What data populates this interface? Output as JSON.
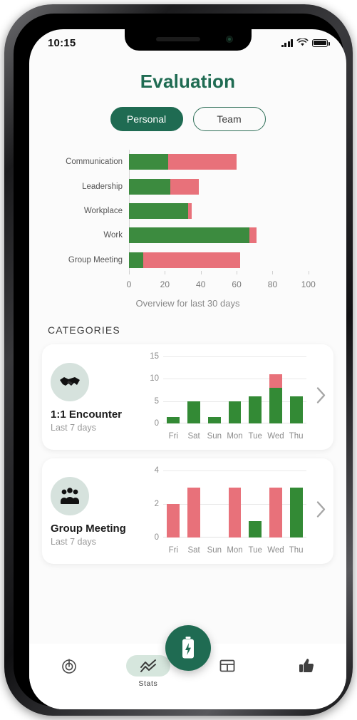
{
  "status_bar": {
    "time": "10:15",
    "signal_icon": "cellular-signal-icon",
    "wifi_icon": "wifi-icon",
    "battery_icon": "battery-icon"
  },
  "header": {
    "title": "Evaluation"
  },
  "segmented": {
    "options": [
      {
        "label": "Personal",
        "active": true
      },
      {
        "label": "Team",
        "active": false
      }
    ]
  },
  "section": {
    "categories_title": "CATEGORIES"
  },
  "colors": {
    "brand_green": "#1f6b52",
    "bar_green": "#3c8b3f",
    "bar_red": "#e8717a",
    "icon_bg": "#d6e2dd",
    "screen_bg": "#fbfbfb"
  },
  "cards": [
    {
      "name": "1:1 Encounter",
      "subtitle": "Last 7 days",
      "icon": "handshake-icon",
      "chevron": "chevron-right-icon"
    },
    {
      "name": "Group Meeting",
      "subtitle": "Last 7 days",
      "icon": "group-people-icon",
      "chevron": "chevron-right-icon"
    }
  ],
  "tabbar": {
    "items": [
      {
        "label": "",
        "icon": "radar-target-icon",
        "active": false
      },
      {
        "label": "Stats",
        "icon": "chart-lines-icon",
        "active": true
      },
      {
        "label": "",
        "icon": "table-layout-icon",
        "active": false
      },
      {
        "label": "",
        "icon": "thumbs-up-icon",
        "active": false
      }
    ],
    "fab_icon": "battery-bolt-icon"
  },
  "chart_data": [
    {
      "type": "bar",
      "orientation": "horizontal",
      "stacked": true,
      "title": "",
      "caption": "Overview for last 30 days",
      "categories": [
        "Communication",
        "Leadership",
        "Workplace",
        "Work",
        "Group Meeting"
      ],
      "series": [
        {
          "name": "positive",
          "color": "#3c8b3f",
          "values": [
            22,
            23,
            33,
            67,
            8
          ]
        },
        {
          "name": "negative",
          "color": "#e8717a",
          "values": [
            38,
            16,
            2,
            4,
            54
          ]
        }
      ],
      "totals": [
        60,
        39,
        35,
        71,
        62
      ],
      "xlabel": "",
      "ylabel": "",
      "xlim": [
        0,
        110
      ],
      "xticks": [
        0,
        20,
        40,
        60,
        80,
        100
      ],
      "ticklabels": [
        "0",
        "20",
        "40",
        "60",
        "80",
        "100"
      ],
      "grid": false,
      "legend": "none"
    },
    {
      "type": "bar",
      "orientation": "vertical",
      "stacked": true,
      "title": "1:1 Encounter",
      "categories": [
        "Fri",
        "Sat",
        "Sun",
        "Mon",
        "Tue",
        "Wed",
        "Thu"
      ],
      "series": [
        {
          "name": "positive",
          "color": "#338a35",
          "values": [
            1.5,
            5,
            1.5,
            5,
            6,
            8,
            6
          ]
        },
        {
          "name": "negative",
          "color": "#e8717a",
          "values": [
            0,
            0,
            0,
            0,
            0,
            3,
            0
          ]
        }
      ],
      "totals": [
        1.5,
        5,
        1.5,
        5,
        6,
        11,
        6
      ],
      "ylim": [
        0,
        15
      ],
      "yticks": [
        0,
        5,
        10,
        15
      ],
      "yticklabels": [
        "0",
        "5",
        "10",
        "15"
      ],
      "grid": true,
      "legend": "none"
    },
    {
      "type": "bar",
      "orientation": "vertical",
      "stacked": true,
      "title": "Group Meeting",
      "categories": [
        "Fri",
        "Sat",
        "Sun",
        "Mon",
        "Tue",
        "Wed",
        "Thu"
      ],
      "series": [
        {
          "name": "positive",
          "color": "#338a35",
          "values": [
            0,
            0,
            0,
            0,
            1,
            0,
            3
          ]
        },
        {
          "name": "negative",
          "color": "#e8717a",
          "values": [
            2,
            3,
            0,
            3,
            0,
            3,
            0
          ]
        }
      ],
      "totals": [
        2,
        3,
        0,
        3,
        1,
        3,
        3
      ],
      "ylim": [
        0,
        4
      ],
      "yticks": [
        0,
        2,
        4
      ],
      "yticklabels": [
        "0",
        "2",
        "4"
      ],
      "grid": true,
      "legend": "none"
    }
  ]
}
